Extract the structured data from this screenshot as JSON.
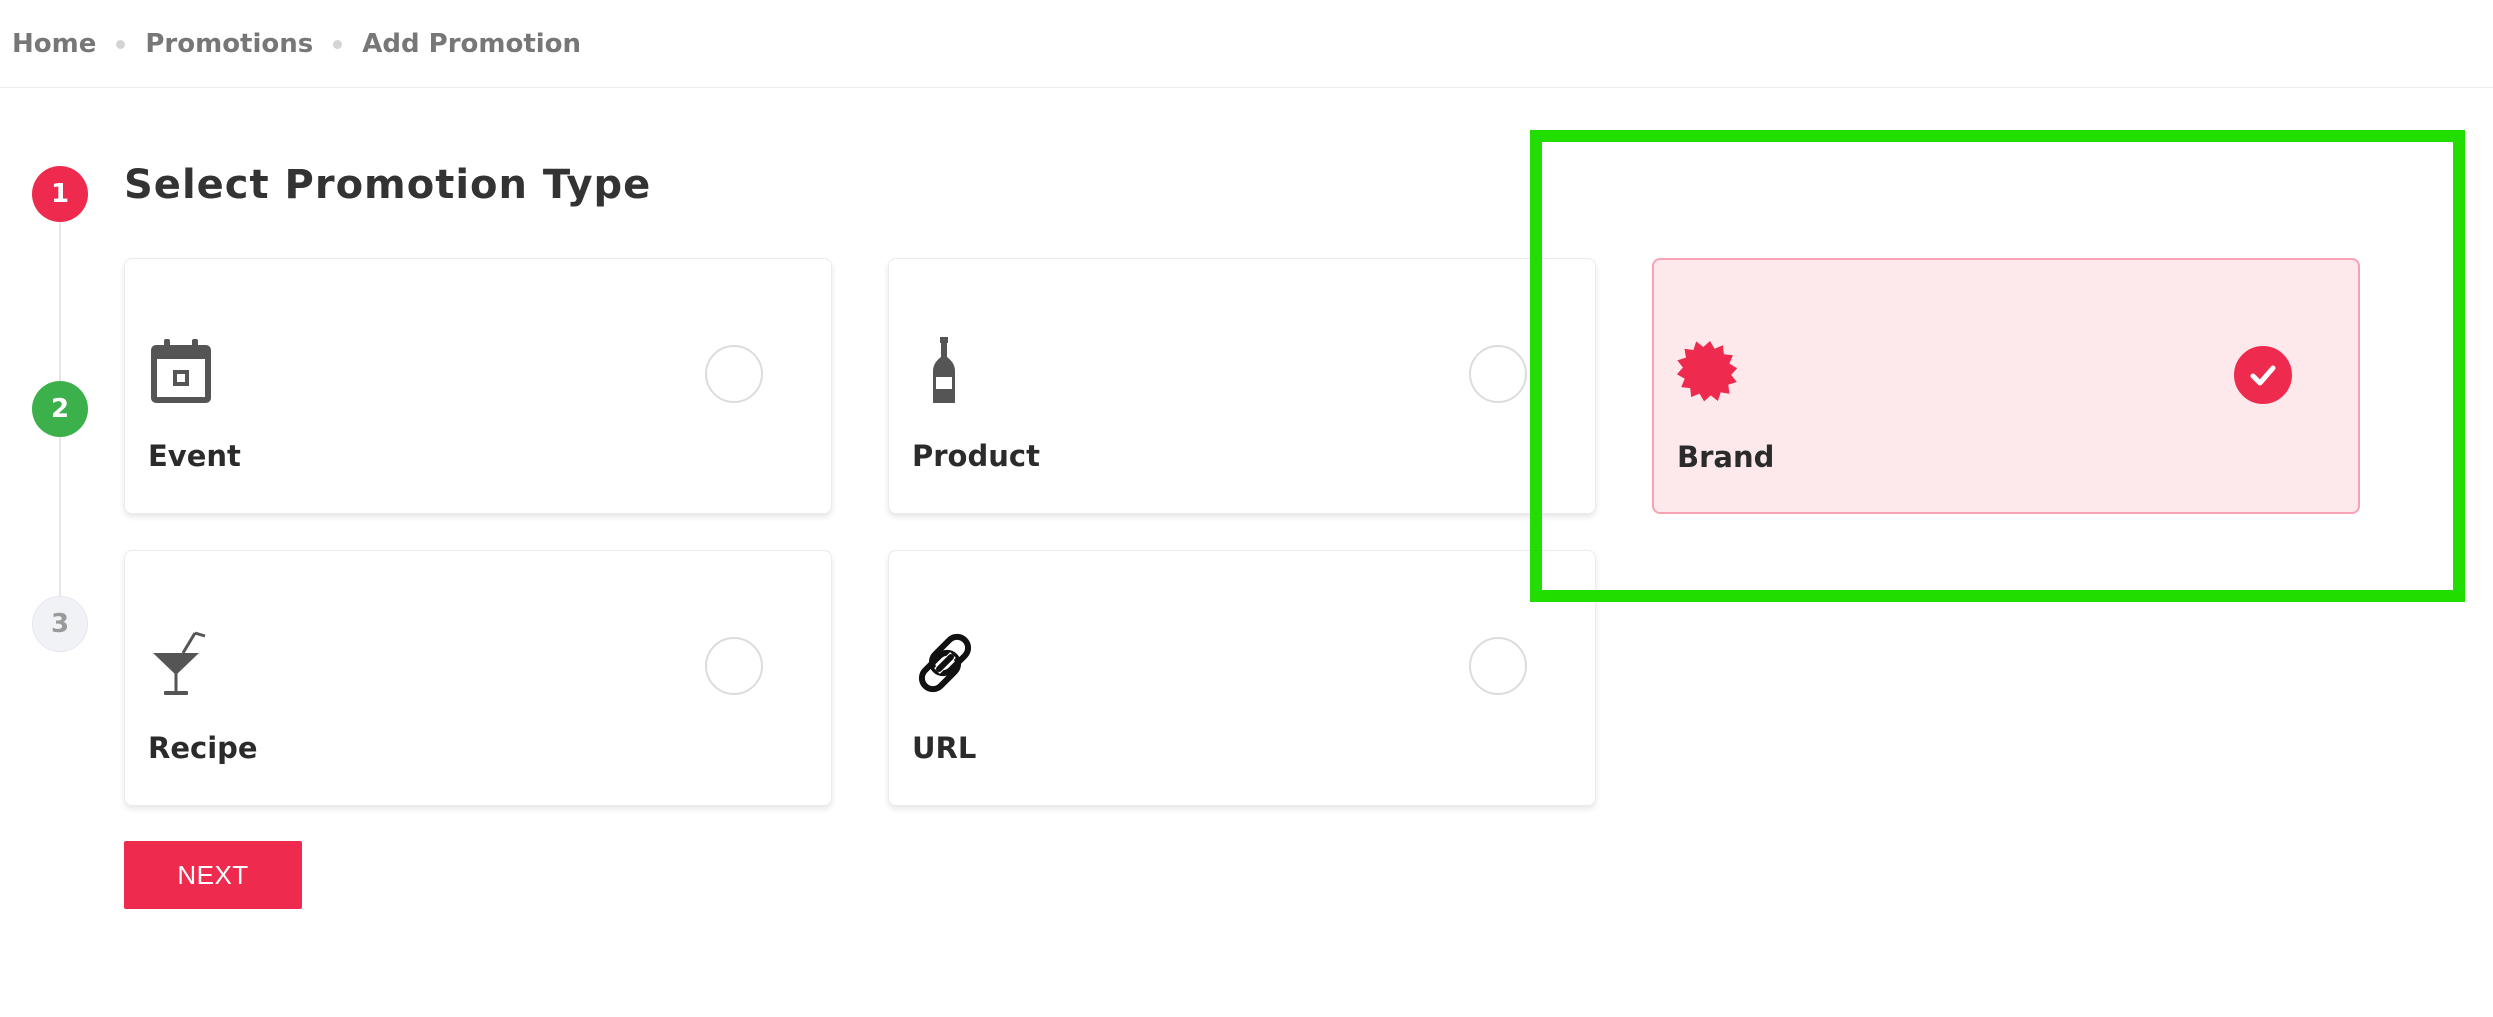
{
  "breadcrumb": {
    "items": [
      "Home",
      "Promotions",
      "Add Promotion"
    ]
  },
  "stepper": {
    "steps": [
      "1",
      "2",
      "3"
    ],
    "active_color": "#ee2b4e",
    "done_color": "#3cb04a"
  },
  "section": {
    "title": "Select Promotion Type"
  },
  "promotion_types": [
    {
      "label": "Event",
      "icon": "calendar-icon",
      "selected": false
    },
    {
      "label": "Product",
      "icon": "bottle-icon",
      "selected": false
    },
    {
      "label": "Brand",
      "icon": "starburst-badge-icon",
      "selected": true
    },
    {
      "label": "Recipe",
      "icon": "cocktail-glass-icon",
      "selected": false
    },
    {
      "label": "URL",
      "icon": "link-icon",
      "selected": false
    }
  ],
  "actions": {
    "next_label": "NEXT"
  },
  "colors": {
    "accent": "#ee2b4e",
    "selected_bg": "#fde9ec",
    "highlight": "#22dd00"
  }
}
